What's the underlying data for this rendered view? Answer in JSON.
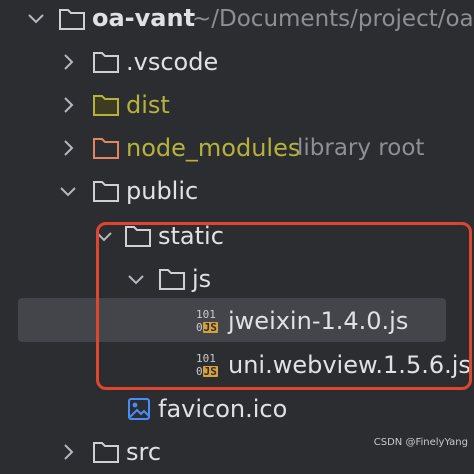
{
  "tree": {
    "root": {
      "name": "oa-vant",
      "path": "~/Documents/project/oa-"
    },
    "vscode": {
      "name": ".vscode"
    },
    "dist": {
      "name": "dist"
    },
    "node_modules": {
      "name": "node_modules",
      "suffix": "library root"
    },
    "public": {
      "name": "public"
    },
    "static": {
      "name": "static"
    },
    "js": {
      "name": "js"
    },
    "jweixin": {
      "name": "jweixin-1.4.0.js",
      "icon_top": "101",
      "icon_prefix": "0",
      "icon_badge": "JS"
    },
    "uniwebview": {
      "name": "uni.webview.1.5.6.js",
      "icon_top": "101",
      "icon_prefix": "0",
      "icon_badge": "JS"
    },
    "favicon": {
      "name": "favicon.ico"
    },
    "src": {
      "name": "src"
    }
  },
  "watermark": "CSDN @FinelyYang",
  "colors": {
    "background": "#2b2d30",
    "selection": "#43454a",
    "highlight_border": "#e0462f",
    "excluded_folder": "#b5b33c",
    "library_folder": "#e1875e",
    "js_badge": "#d7a23c",
    "image_icon": "#4a8df8"
  }
}
